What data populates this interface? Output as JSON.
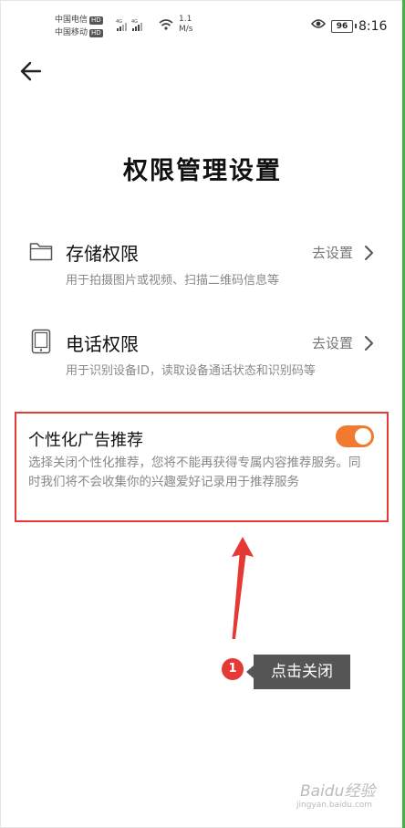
{
  "status_bar": {
    "carrier1": "中国电信",
    "carrier2": "中国移动",
    "hd": "HD",
    "signal_tag": "4G",
    "net_speed_value": "1.1",
    "net_speed_unit": "M/s",
    "battery": "96",
    "time": "8:16"
  },
  "page": {
    "title": "权限管理设置"
  },
  "permissions": [
    {
      "name": "存储权限",
      "action": "去设置",
      "desc": "用于拍摄图片或视频、扫描二维码信息等",
      "icon": "folder-icon"
    },
    {
      "name": "电话权限",
      "action": "去设置",
      "desc": "用于识别设备ID，读取设备通话状态和识别码等",
      "icon": "phone-icon"
    }
  ],
  "ad": {
    "title": "个性化广告推荐",
    "desc": "选择关闭个性化推荐，您将不能再获得专属内容推荐服务。同时我们将不会收集你的兴趣爱好记录用于推荐服务",
    "enabled": true
  },
  "annotation": {
    "step": "1",
    "label": "点击关闭"
  },
  "watermark": {
    "brand": "Baidu经验",
    "url": "jingyan.baidu.com"
  },
  "colors": {
    "toggle_on": "#f07a30",
    "highlight": "#e53935",
    "accent": "#3fb24a"
  }
}
